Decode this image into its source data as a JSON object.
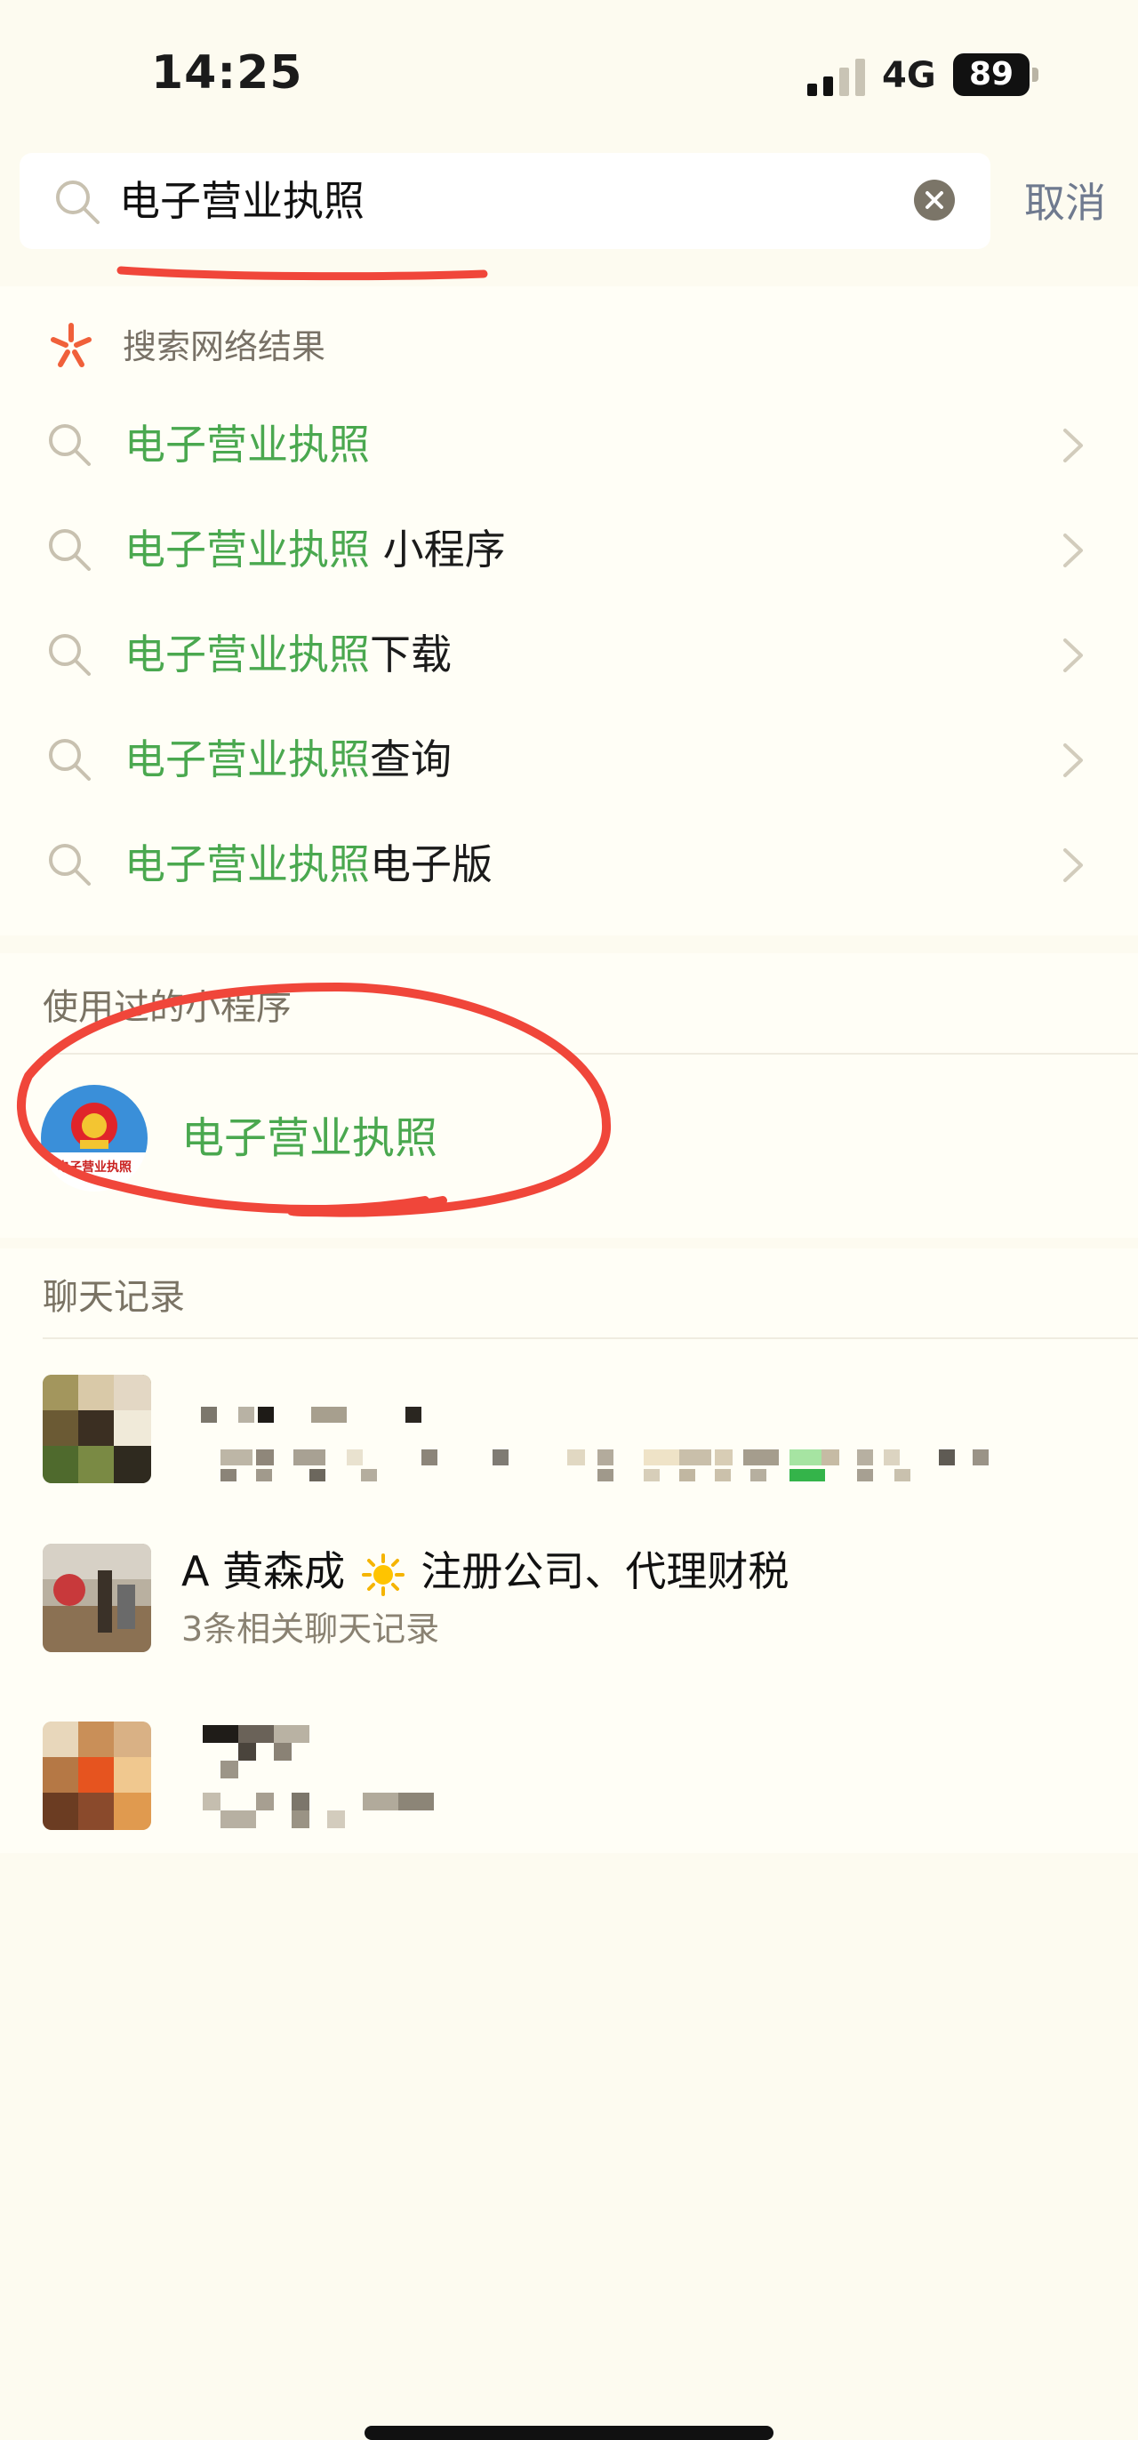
{
  "status_bar": {
    "time": "14:25",
    "network": "4G",
    "battery": "89"
  },
  "search": {
    "value": "电子营业执照",
    "cancel_label": "取消"
  },
  "web_results": {
    "header": "搜索网络结果",
    "items": [
      {
        "highlight": "电子营业执照",
        "rest": ""
      },
      {
        "highlight": "电子营业执照",
        "rest": " 小程序"
      },
      {
        "highlight": "电子营业执照",
        "rest": "下载"
      },
      {
        "highlight": "电子营业执照",
        "rest": "查询"
      },
      {
        "highlight": "电子营业执照",
        "rest": "电子版"
      }
    ]
  },
  "mini_programs": {
    "title": "使用过的小程序",
    "items": [
      {
        "name": "电子营业执照",
        "badge_text": "电子营业执照"
      }
    ]
  },
  "chat_records": {
    "title": "聊天记录",
    "named_contact": {
      "name_prefix": "A 黄森成",
      "name_suffix": "注册公司、代理财税",
      "sub": "3条相关聊天记录"
    }
  },
  "colors": {
    "highlight": "#4aa84f",
    "annotation": "#f0463a",
    "background": "#fdfbf0"
  },
  "icons": [
    "search-icon",
    "clear-icon",
    "web-search-icon",
    "chevron-right-icon",
    "sun-icon"
  ]
}
